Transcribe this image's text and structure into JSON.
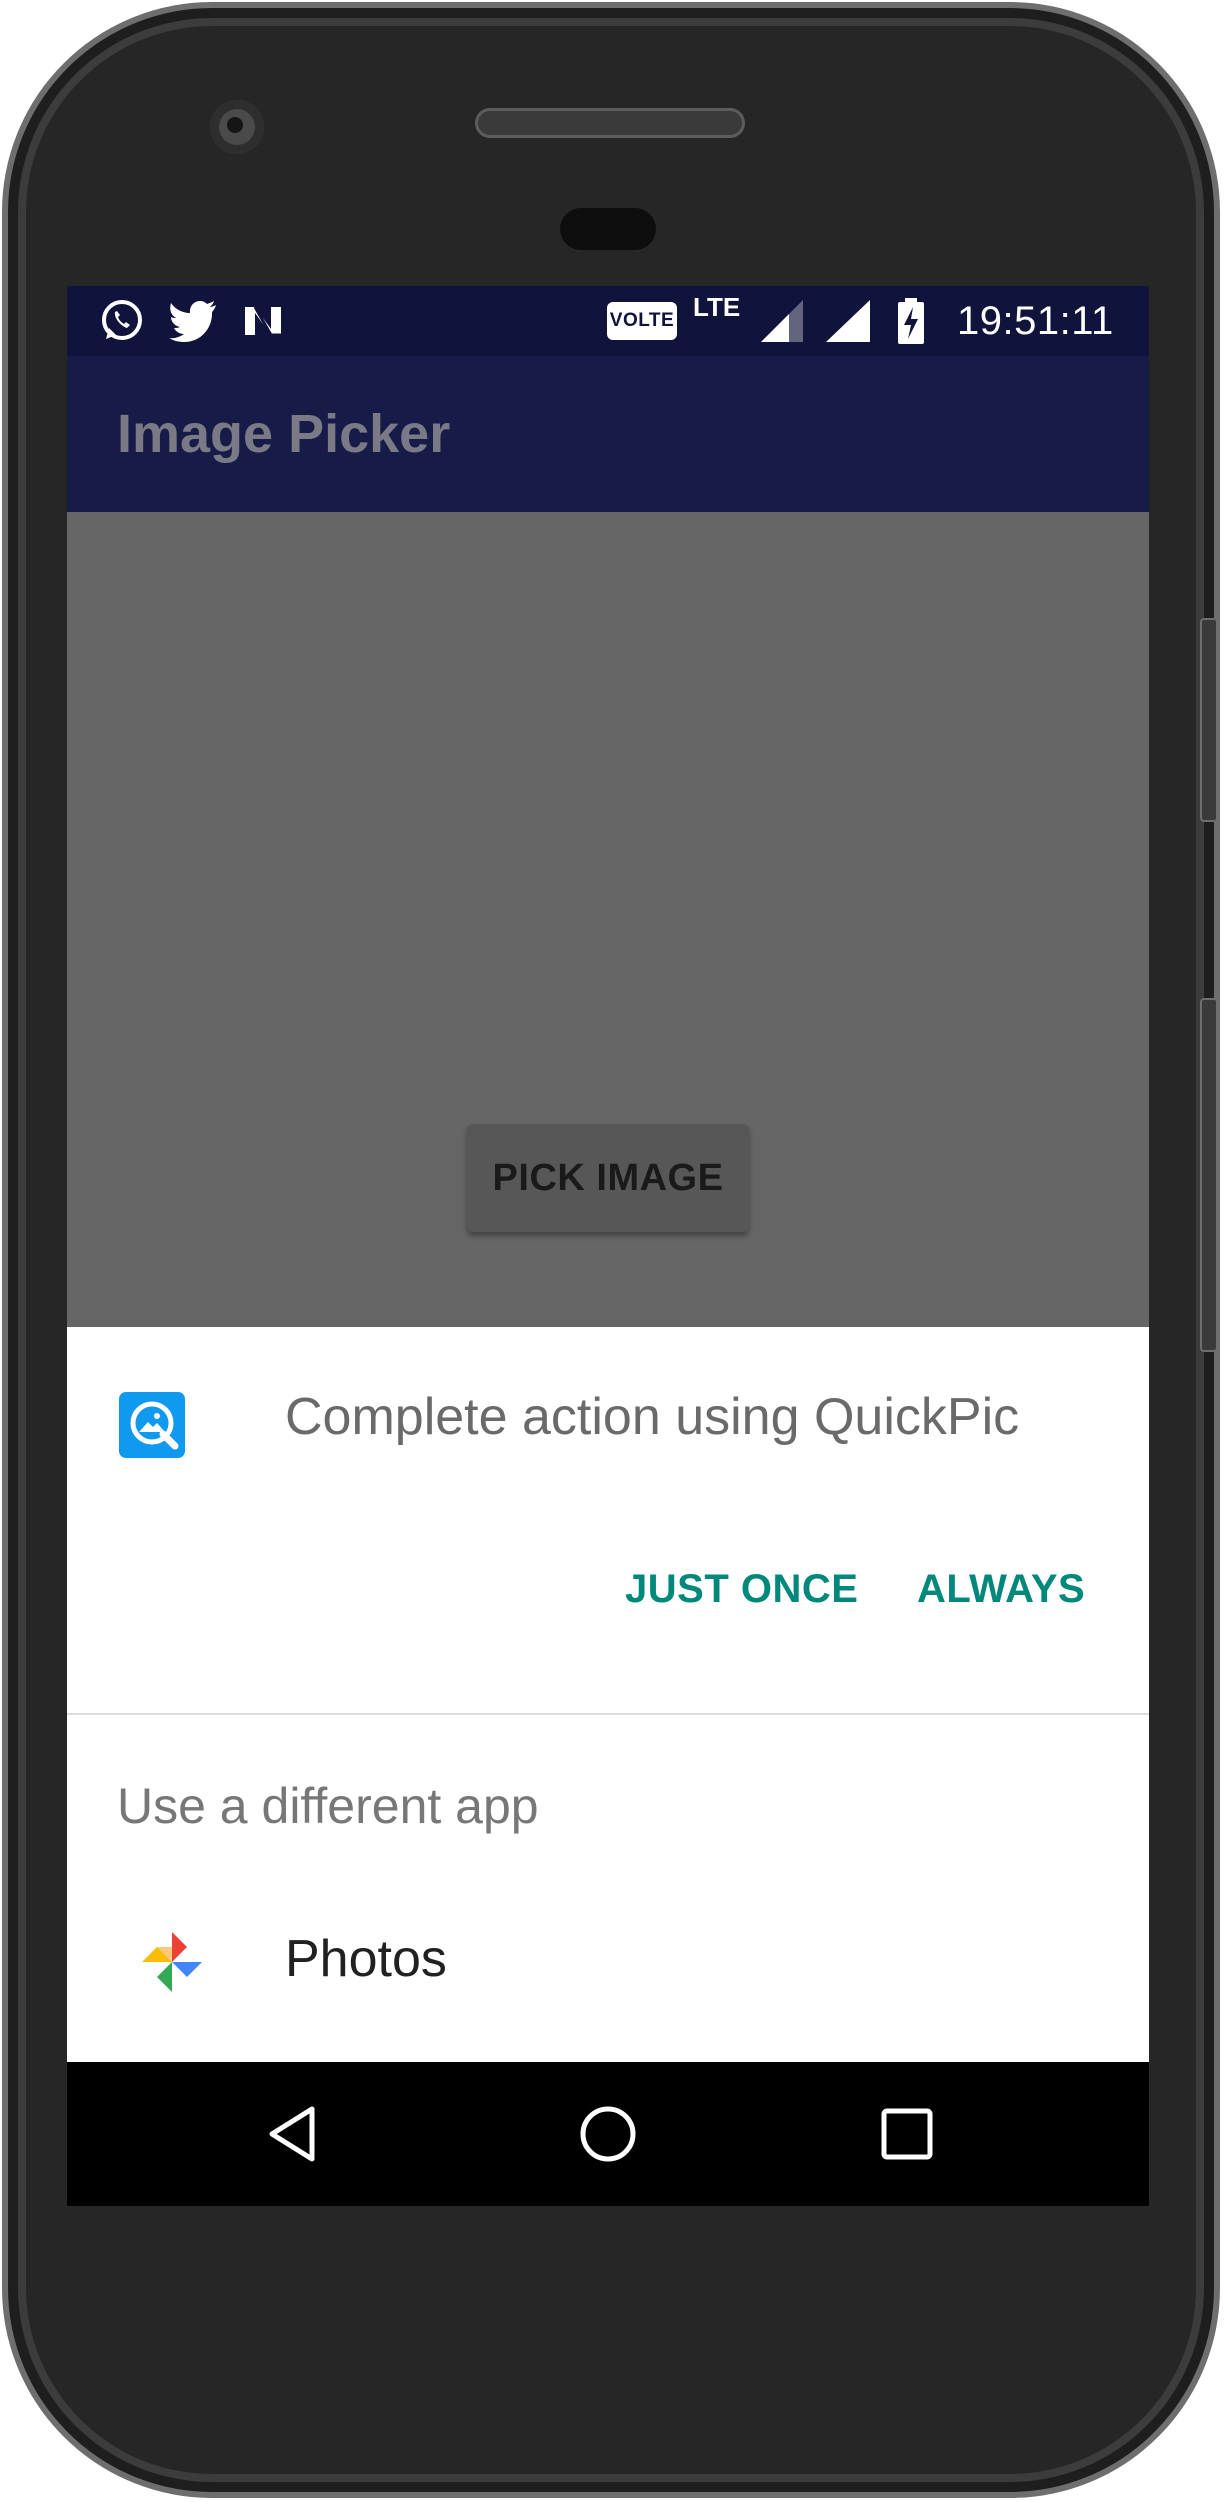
{
  "status_bar": {
    "notification_icons": [
      "whatsapp-icon",
      "twitter-icon",
      "n-notification-icon"
    ],
    "volte": "VOLTE",
    "network": "LTE",
    "system_icons": [
      "signal-icon",
      "signal-icon",
      "battery-charging-icon"
    ],
    "time": "19:51:11"
  },
  "app_bar": {
    "title": "Image Picker"
  },
  "main": {
    "pick_button_label": "PICK IMAGE"
  },
  "chooser": {
    "app_icon": "quickpic-icon",
    "title": "Complete action using QuickPic",
    "just_once_label": "JUST ONCE",
    "always_label": "ALWAYS",
    "other_apps_title": "Use a different app",
    "apps": [
      {
        "icon": "google-photos-icon",
        "label": "Photos"
      }
    ]
  },
  "nav_bar": {
    "buttons": [
      "back-icon",
      "home-icon",
      "recents-icon"
    ]
  },
  "colors": {
    "status_bar": "#10133b",
    "app_bar": "#171b48",
    "dim_overlay": "#666666",
    "accent": "#00897b"
  }
}
